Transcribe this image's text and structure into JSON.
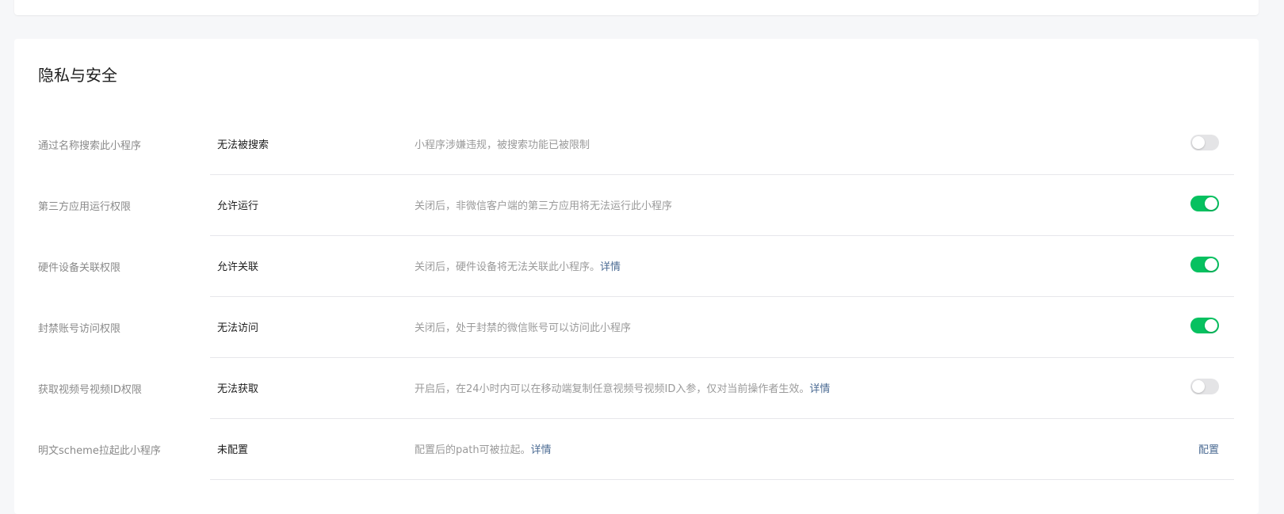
{
  "section": {
    "title": "隐私与安全"
  },
  "rows": [
    {
      "label": "通过名称搜索此小程序",
      "value": "无法被搜索",
      "desc": "小程序涉嫌违规，被搜索功能已被限制",
      "link": "",
      "control": "switch",
      "on": false
    },
    {
      "label": "第三方应用运行权限",
      "value": "允许运行",
      "desc": "关闭后，非微信客户端的第三方应用将无法运行此小程序",
      "link": "",
      "control": "switch",
      "on": true
    },
    {
      "label": "硬件设备关联权限",
      "value": "允许关联",
      "desc": "关闭后，硬件设备将无法关联此小程序。",
      "link": "详情",
      "control": "switch",
      "on": true
    },
    {
      "label": "封禁账号访问权限",
      "value": "无法访问",
      "desc": "关闭后，处于封禁的微信账号可以访问此小程序",
      "link": "",
      "control": "switch",
      "on": true
    },
    {
      "label": "获取视频号视频ID权限",
      "value": "无法获取",
      "desc": "开启后，在24小时内可以在移动端复制任意视频号视频ID入参，仅对当前操作者生效。",
      "link": "详情",
      "control": "switch",
      "on": false
    },
    {
      "label": "明文scheme拉起此小程序",
      "value": "未配置",
      "desc": "配置后的path可被拉起。",
      "link": "详情",
      "control": "link",
      "action_label": "配置"
    }
  ],
  "colors": {
    "switch_on": "#07c160",
    "switch_off": "#e4e4e6",
    "link": "#4b6b93"
  }
}
